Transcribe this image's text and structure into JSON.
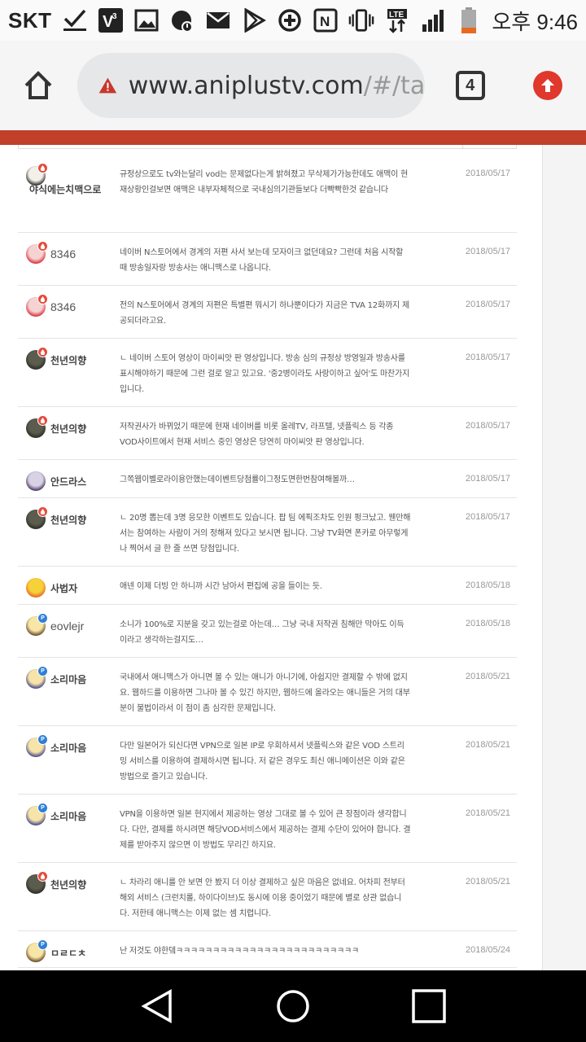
{
  "status_bar": {
    "carrier": "SKT",
    "clock": "오후 9:46",
    "battery_color": "#e86a1f",
    "icons": [
      "check-download-icon",
      "v3-shield-icon",
      "gallery-icon",
      "alarm-icon",
      "mail-icon",
      "play-store-icon",
      "data-saver-icon",
      "nfc-icon",
      "vibrate-icon",
      "lte-icon",
      "signal-icon",
      "battery-icon"
    ]
  },
  "browser": {
    "url_host": "www.aniplustv.com",
    "url_path": "/#/ta",
    "tab_count": "4",
    "accent": "#e0382c"
  },
  "site": {
    "nav_color": "#c0402a"
  },
  "comments": [
    {
      "nick": "야식에는치맥으로",
      "text": "규정상으로도 tv와는달리 vod는 문제없다는게 밝혀졌고 무삭제가가능한데도 애맥이 현재상황인걸보면 애맥은 내부자체적으로 국내심의기관들보다 더빡빡한것 같습니다",
      "date": "2018/05/17",
      "avatar": "girl-avatar-1",
      "badge": "fire"
    },
    {
      "nick": "8346",
      "text": "네이버 N스토어에서 경계의 저편 사서 보는데 모자이크 없던데요? 그런데 처음 시작할 때 방송일자랑 방송사는 애니맥스로 나옵니다.",
      "date": "2018/05/17",
      "avatar": "red-hair-avatar",
      "badge": "fire"
    },
    {
      "nick": "8346",
      "text": "전의 N스토어에서 경계의 저편은 특별편 뭐시기 하나뿐이다가 지금은 TVA 12화까지 제공되더라고요.",
      "date": "2018/05/17",
      "avatar": "red-hair-avatar",
      "badge": "fire"
    },
    {
      "nick": "천년의향",
      "text": "ㄴ 네이버 스토어 영상이 마이씨앗 판 영상입니다. 방송 심의 규정상 방영일과 방송사를 표시해야하기 때문에 그런 걸로 알고 있고요. '중2병이라도 사랑이하고 싶어'도 마찬가지 입니다.",
      "date": "2018/05/17",
      "avatar": "dark-avatar",
      "badge": "fire"
    },
    {
      "nick": "천년의향",
      "text": "저작권사가 바뀌었기 때문에 현재 네이버를 비롯 올레TV, 라프텔, 넷플릭스 등 각종 VOD사이트에서 현재 서비스 중인 영상은 당연히 마이씨앗 판 영상입니다.",
      "date": "2018/05/17",
      "avatar": "dark-avatar",
      "badge": "fire"
    },
    {
      "nick": "안드라스",
      "text": "그쪽웹이벨로라이용안했는데이벤트당첨률이그정도면한번참여해볼까…",
      "date": "2018/05/17",
      "avatar": "purple-avatar",
      "badge": "none"
    },
    {
      "nick": "천년의향",
      "text": "ㄴ 20명 뽑는데 3명 응모한 이벤트도 있습니다. 팝 팀 에픽조차도 인원 펑크났고. 웬만해서는 참여하는 사람이 거의 정해져 있다고 보시면 됩니다. 그냥 TV화면 폰카로 아무렇게나 찍어서 글 한 줄 쓰면 당첨입니다.",
      "date": "2018/05/17",
      "avatar": "dark-avatar",
      "badge": "fire"
    },
    {
      "nick": "사법자",
      "text": "애넨 이제 더빙 안 하니까 시간 남아서 편집에 공을 들이는 듯.",
      "date": "2018/05/18",
      "avatar": "yellow-robot-avatar",
      "badge": "none"
    },
    {
      "nick": "eovlejr",
      "text": "소니가 100%로 지분을 갖고 있는걸로 아는데… 그냥 국내 저작권 침해만 막아도 이득이라고 생각하는걸지도…",
      "date": "2018/05/18",
      "avatar": "smile-avatar",
      "badge": "p"
    },
    {
      "nick": "소리마음",
      "text": "국내에서 애니맥스가 아니면 볼 수 있는 애니가 아니기에, 아쉽지만 결제할 수 밖에 없지요. 웹하드를 이용하면 그나마 볼 수 있긴 하지만, 웹하드에 올라오는 애니들은 거의 대부분이 불법이라서 이 점이 좀 심각한 문제입니다.",
      "date": "2018/05/21",
      "avatar": "blonde-avatar",
      "badge": "p"
    },
    {
      "nick": "소리마음",
      "text": "다만 일본어가 되신다면 VPN으로 일본 IP로 우회하셔서 넷플릭스와 같은 VOD 스트리밍 서비스를 이용하여 결제하시면 됩니다. 저 같은 경우도 최신 애니메이션은 이와 같은 방법으로 즐기고 있습니다.",
      "date": "2018/05/21",
      "avatar": "blonde-avatar",
      "badge": "p"
    },
    {
      "nick": "소리마음",
      "text": "VPN을 이용하면 일본 현지에서 제공하는 영상 그대로 볼 수 있어 큰 장점이라 생각합니다. 다만, 결제를 하시려면 해당VOD서비스에서 제공하는 결제 수단이 있어야 합니다. 결제를 받아주지 않으면 이 방법도 무리긴 하지요.",
      "date": "2018/05/21",
      "avatar": "blonde-avatar",
      "badge": "p"
    },
    {
      "nick": "천년의향",
      "text": "ㄴ 차라리 애니를 안 보면 안 봤지 더 이상 결제하고 싶은 마음은 없네요. 어차피 전부터 해외 서비스 (크런치롤, 하이다이브)도 동시에 이용 중이었기 때문에 별로 상관 없습니다. 저한테 애니맥스는 이제 없는 셈 치렵니다.",
      "date": "2018/05/21",
      "avatar": "dark-avatar",
      "badge": "fire"
    },
    {
      "nick": "ㅁㄹㄷㅊ",
      "text": "난 저것도 야한뎈ㅋㅋㅋㅋㅋㅋㅋㅋㅋㅋㅋㅋㅋㅋㅋㅋㅋㅋㅋㅋㅋㅋㅋㅋㅋ",
      "date": "2018/05/24",
      "avatar": "smile-avatar",
      "badge": "p"
    }
  ]
}
